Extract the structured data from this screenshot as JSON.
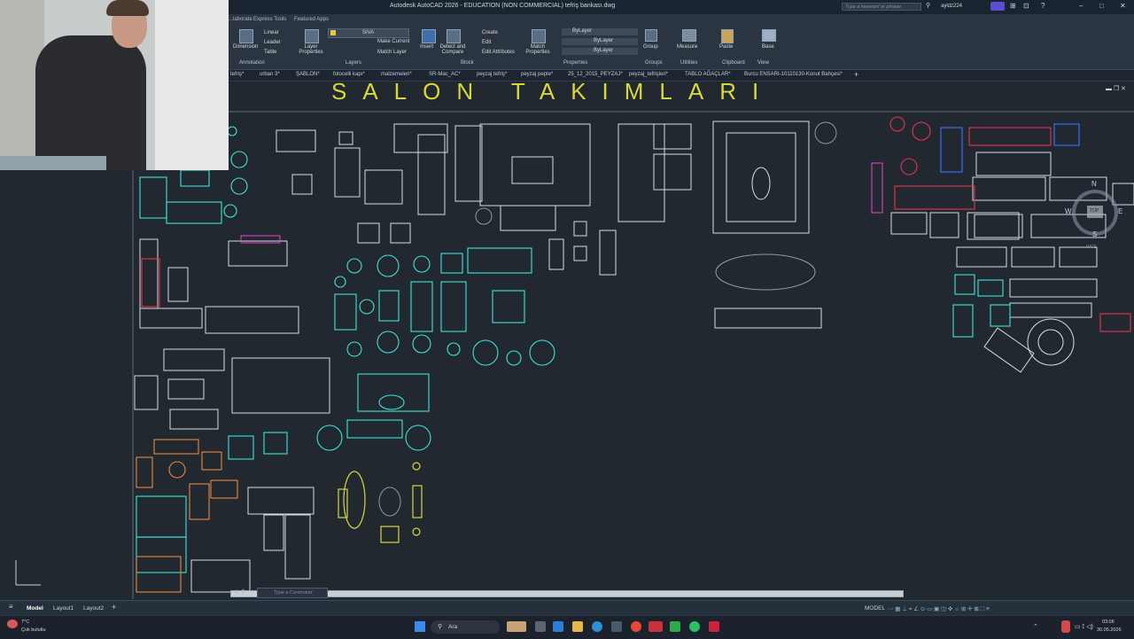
{
  "window": {
    "title": "Autodesk AutoCAD 2026 - EDUCATION (NON COMMERCIAL)   tefriş bankası.dwg",
    "search_placeholder": "Type a keyword or phrase",
    "user": "ayldz224"
  },
  "ribbon": {
    "tabs": [
      "...laborate",
      "Express Tools",
      "Featured Apps"
    ],
    "buttons": {
      "linear": "Linear",
      "leader": "Leader",
      "table": "Table",
      "dimension": "Dimension",
      "layer_properties": "Layer Properties",
      "make_current": "Make Current",
      "match_layer": "Match Layer",
      "insert": "Insert",
      "detect_compare": "Detect and Compare",
      "create": "Create",
      "edit": "Edit",
      "edit_attributes": "Edit Attributes",
      "match_properties": "Match Properties",
      "bylayer1": "ByLayer",
      "bylayer2": "ByLayer",
      "bylayer3": "ByLayer",
      "group": "Group",
      "measure": "Measure",
      "paste": "Paste",
      "base": "Base"
    },
    "layer_name": "SIVA",
    "panels": [
      "Annotation",
      "Layers",
      "Block",
      "Properties",
      "Groups",
      "Utilities",
      "Clipboard",
      "View"
    ]
  },
  "file_tabs": [
    "tefriş*",
    "urban 3*",
    "ŞABLON*",
    "fotocelli kapı*",
    "malzemeleri*",
    "SR-Mac_AC*",
    "peyzaj tefriş*",
    "peyzaj pepte*",
    "25_12_2015_PEYZAJ*",
    "peyzaj_tefrişleri*",
    "TABLO AĞAÇLAR*",
    "Burcu ENSARI-10110130-Konut Bahçesi*"
  ],
  "drawing": {
    "heading": "SALON TAKIMLARI",
    "compass": {
      "n": "N",
      "s": "S",
      "e": "E",
      "w": "W",
      "top": "TOP"
    },
    "wcs": "WCS"
  },
  "command": {
    "placeholder": "Type a Command"
  },
  "status": {
    "tabs": [
      "Model",
      "Layout1",
      "Layout2"
    ],
    "model_label": "MODEL"
  },
  "taskbar": {
    "search": "Ara",
    "weather_temp": "7°C",
    "weather_text": "Çok bulutlu",
    "time": "03:06",
    "date": "30.05.2026"
  },
  "colors": {
    "cyan": "#3ee6d8",
    "white": "#d8dde3",
    "red": "#e8324a",
    "magenta": "#e040c8",
    "orange": "#e8863c",
    "blue": "#3a6ef0",
    "yellow": "#d9d63c"
  }
}
